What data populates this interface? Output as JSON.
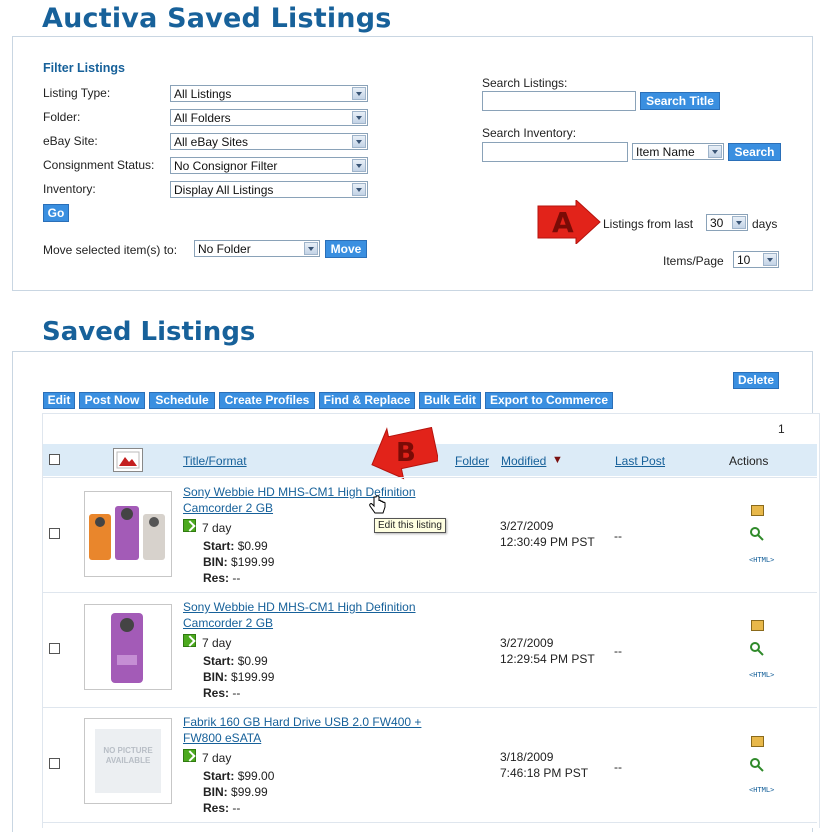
{
  "page_title": "Auctiva Saved Listings",
  "filter": {
    "heading": "Filter Listings",
    "listing_type_label": "Listing Type:",
    "listing_type_value": "All Listings",
    "folder_label": "Folder:",
    "folder_value": "All Folders",
    "ebay_site_label": "eBay Site:",
    "ebay_site_value": "All eBay Sites",
    "consignment_label": "Consignment Status:",
    "consignment_value": "No Consignor Filter",
    "inventory_label": "Inventory:",
    "inventory_value": "Display All Listings",
    "go_label": "Go",
    "move_label": "Move selected item(s) to:",
    "move_folder_value": "No Folder",
    "move_button": "Move",
    "search_listings_label": "Search Listings:",
    "search_listings_value": "",
    "search_title_button": "Search Title",
    "search_inventory_label": "Search Inventory:",
    "search_inventory_value": "",
    "inventory_field_value": "Item Name",
    "search_button": "Search",
    "listings_from_label": "Listings from last",
    "listings_from_value": "30",
    "days_label": "days",
    "items_per_page_label": "Items/Page",
    "items_per_page_value": "10"
  },
  "annotations": {
    "a": "A",
    "b": "B"
  },
  "saved_listings": {
    "heading": "Saved Listings",
    "delete_button": "Delete",
    "toolbar": [
      "Edit",
      "Post Now",
      "Schedule",
      "Create Profiles",
      "Find & Replace",
      "Bulk Edit",
      "Export to Commerce"
    ],
    "page_number": "1",
    "columns": {
      "title": "Title/Format",
      "folder": "Folder",
      "modified": "Modified",
      "sort_indicator": "▼",
      "last_post": "Last Post",
      "actions": "Actions"
    },
    "tooltip": "Edit this listing",
    "rows": [
      {
        "title_line1": "Sony Webbie HD MHS-CM1 High Definition",
        "title_line2": "Camcorder 2 GB",
        "duration": "7 day",
        "start_label": "Start:",
        "start_value": "$0.99",
        "bin_label": "BIN:",
        "bin_value": "$199.99",
        "res_label": "Res:",
        "res_value": "--",
        "modified_date": "3/27/2009",
        "modified_time": "12:30:49 PM PST",
        "last_post": "--",
        "html_tag": "<HTML>"
      },
      {
        "title_line1": "Sony Webbie HD MHS-CM1 High Definition",
        "title_line2": "Camcorder 2 GB",
        "duration": "7 day",
        "start_label": "Start:",
        "start_value": "$0.99",
        "bin_label": "BIN:",
        "bin_value": "$199.99",
        "res_label": "Res:",
        "res_value": "--",
        "modified_date": "3/27/2009",
        "modified_time": "12:29:54 PM PST",
        "last_post": "--",
        "html_tag": "<HTML>"
      },
      {
        "title_line1": "Fabrik 160 GB Hard Drive USB 2.0 FW400 +",
        "title_line2": "FW800 eSATA",
        "duration": "7 day",
        "start_label": "Start:",
        "start_value": "$99.00",
        "bin_label": "BIN:",
        "bin_value": "$99.99",
        "res_label": "Res:",
        "res_value": "--",
        "modified_date": "3/18/2009",
        "modified_time": "7:46:18 PM PST",
        "last_post": "--",
        "html_tag": "<HTML>",
        "no_picture_text": "NO PICTURE AVAILABLE"
      }
    ]
  },
  "colors": {
    "heading": "#17619a",
    "button": "#3a8fe0",
    "header_bg": "#dcebf7",
    "arrow_red": "#e2231a"
  }
}
